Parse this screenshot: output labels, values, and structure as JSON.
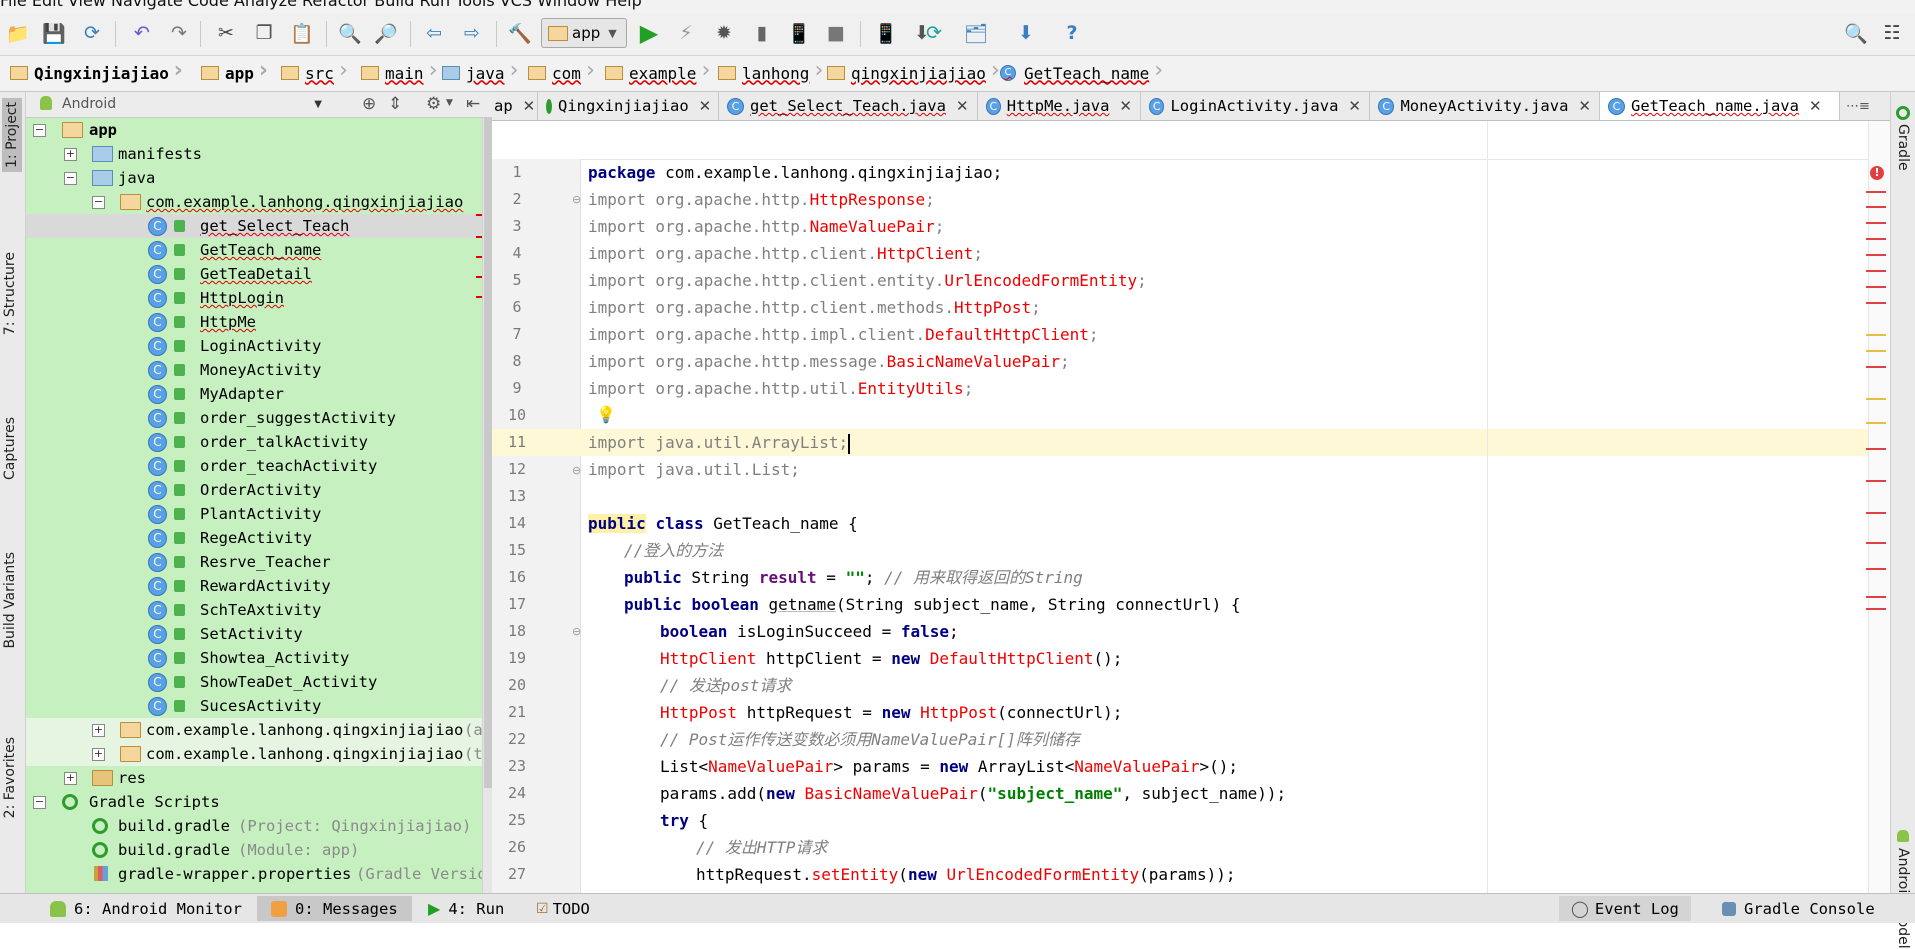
{
  "menu": {
    "items": [
      "File",
      "Edit",
      "View",
      "Navigate",
      "Code",
      "Analyze",
      "Refactor",
      "Build",
      "Run",
      "Tools",
      "VCS",
      "Window",
      "Help"
    ]
  },
  "toolbar": {
    "run_config": "app"
  },
  "breadcrumb": [
    "Qingxinjiajiao",
    "app",
    "src",
    "main",
    "java",
    "com",
    "example",
    "lanhong",
    "qingxinjiajiao",
    "GetTeach_name"
  ],
  "project_panel": {
    "view_selector": "Android"
  },
  "left_tabs": [
    "1: Project",
    "7: Structure",
    "Captures",
    "Build Variants",
    "2: Favorites"
  ],
  "right_tabs": [
    "Gradle",
    "Android Model"
  ],
  "tree": [
    {
      "label": "app",
      "bold": true
    },
    {
      "label": "manifests"
    },
    {
      "label": "java"
    },
    {
      "label": "com.example.lanhong.qingxinjiajiao"
    },
    {
      "label": "get_Select_Teach"
    },
    {
      "label": "GetTeach_name"
    },
    {
      "label": "GetTeaDetail"
    },
    {
      "label": "HttpLogin"
    },
    {
      "label": "HttpMe"
    },
    {
      "label": "LoginActivity"
    },
    {
      "label": "MoneyActivity"
    },
    {
      "label": "MyAdapter"
    },
    {
      "label": "order_suggestActivity"
    },
    {
      "label": "order_talkActivity"
    },
    {
      "label": "order_teachActivity"
    },
    {
      "label": "OrderActivity"
    },
    {
      "label": "PlantActivity"
    },
    {
      "label": "RegeActivity"
    },
    {
      "label": "Resrve_Teacher"
    },
    {
      "label": "RewardActivity"
    },
    {
      "label": "SchTeAxtivity"
    },
    {
      "label": "SetActivity"
    },
    {
      "label": "Showtea_Activity"
    },
    {
      "label": "ShowTeaDet_Activity"
    },
    {
      "label": "SucesActivity"
    },
    {
      "label": "com.example.lanhong.qingxinjiajiao",
      "suffix": "(and"
    },
    {
      "label": "com.example.lanhong.qingxinjiajiao",
      "suffix": "(te"
    },
    {
      "label": "res"
    },
    {
      "label": "Gradle Scripts"
    },
    {
      "label": "build.gradle",
      "suffix": "(Project: Qingxinjiajiao)"
    },
    {
      "label": "build.gradle",
      "suffix": "(Module: app)"
    },
    {
      "label": "gradle-wrapper.properties",
      "suffix": "(Gradle Version)"
    }
  ],
  "tabs": [
    {
      "label": "ap"
    },
    {
      "label": "Qingxinjiajiao"
    },
    {
      "label": "get_Select_Teach.java"
    },
    {
      "label": "HttpMe.java"
    },
    {
      "label": "LoginActivity.java"
    },
    {
      "label": "MoneyActivity.java"
    },
    {
      "label": "GetTeach_name.java"
    },
    {
      "label": "⋯≡"
    }
  ],
  "code": {
    "line_numbers": [
      "1",
      "2",
      "3",
      "4",
      "5",
      "6",
      "7",
      "8",
      "9",
      "10",
      "11",
      "12",
      "13",
      "14",
      "15",
      "16",
      "17",
      "18",
      "19",
      "20",
      "21",
      "22",
      "23",
      "24",
      "25",
      "26",
      "27"
    ],
    "l1a": "package",
    "l1b": " com.example.lanhong.qingxinjiajiao;",
    "imp": "import",
    "l2a": " org.apache.http.",
    "l2b": "HttpResponse",
    "l2c": ";",
    "l3a": " org.apache.http.",
    "l3b": "NameValuePair",
    "l3c": ";",
    "l4a": " org.apache.http.client.",
    "l4b": "HttpClient",
    "l4c": ";",
    "l5a": " org.apache.http.client.entity.",
    "l5b": "UrlEncodedFormEntity",
    "l5c": ";",
    "l6a": " org.apache.http.client.methods.",
    "l6b": "HttpPost",
    "l6c": ";",
    "l7a": " org.apache.http.impl.client.",
    "l7b": "DefaultHttpClient",
    "l7c": ";",
    "l8a": " org.apache.http.message.",
    "l8b": "BasicNameValuePair",
    "l8c": ";",
    "l9a": " org.apache.http.util.",
    "l9b": "EntityUtils",
    "l9c": ";",
    "l11a": " java.util.ArrayList;",
    "l12a": " java.util.List;",
    "l14a": "public",
    "l14b": "class",
    "l14c": " GetTeach_name {",
    "l15a": "//登入的方法",
    "l16a": "public",
    "l16b": " String ",
    "l16c": "result",
    "l16d": " = ",
    "l16e": "\"\"",
    "l16f": "; ",
    "l16g": "// 用来取得返回的String",
    "l17a": "public",
    "l17b": "boolean",
    "l17c": "getname",
    "l17d": "(String subject_name, String connectUrl) {",
    "l18a": "boolean",
    "l18b": " isLoginSucceed = ",
    "l18c": "false",
    "l18d": ";",
    "l19a": "HttpClient",
    "l19b": " httpClient = ",
    "l19c": "new",
    "l19d": "DefaultHttpClient",
    "l19e": "();",
    "l20a": "// 发送post请求",
    "l21a": "HttpPost",
    "l21b": " httpRequest = ",
    "l21c": "new",
    "l21d": "HttpPost",
    "l21e": "(connectUrl);",
    "l22a": "// Post运作传送变数必须用NameValuePair[]阵列储存",
    "l23a": "List<",
    "l23b": "NameValuePair",
    "l23c": "> params = ",
    "l23d": "new",
    "l23e": " ArrayList<",
    "l23f": "NameValuePair",
    "l23g": ">();",
    "l24a": "params.add(",
    "l24b": "new",
    "l24c": "BasicNameValuePair",
    "l24d": "(",
    "l24e": "\"subject_name\"",
    "l24f": ", subject_name));",
    "l25a": "try",
    "l25b": " {",
    "l26a": "// 发出HTTP请求",
    "l27a": "httpRequest.",
    "l27b": "setEntity",
    "l27c": "(",
    "l27d": "new",
    "l27e": "UrlEncodedFormEntity",
    "l27f": "(params));"
  },
  "bottom": {
    "android_monitor": "6: Android Monitor",
    "messages": "0: Messages",
    "run": "4: Run",
    "todo": "TODO",
    "event_log": "Event Log",
    "gradle_console": "Gradle Console"
  },
  "colors": {
    "project_bg": "#c7f0c1",
    "keyword": "#000080",
    "error_red": "#ee0000",
    "string_green": "#008000",
    "comment_gray": "#808080"
  }
}
